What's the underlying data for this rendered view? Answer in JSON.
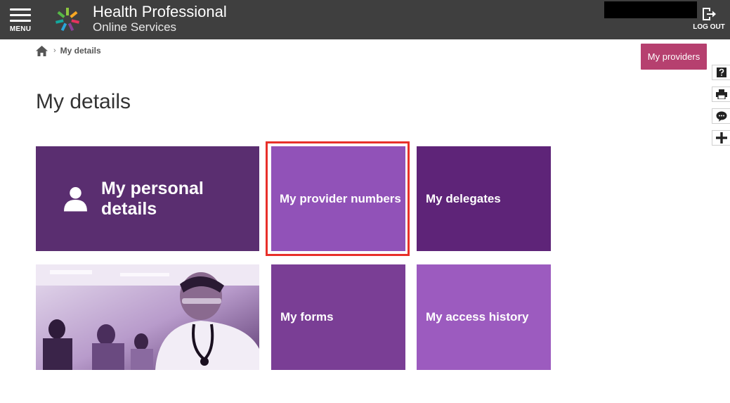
{
  "header": {
    "menu_label": "MENU",
    "brand_line1": "Health Professional",
    "brand_line2": "Online Services",
    "logout_label": "LOG OUT"
  },
  "breadcrumb": {
    "current": "My details"
  },
  "actions": {
    "my_providers": "My providers"
  },
  "page": {
    "title": "My details"
  },
  "tiles": {
    "personal": "My personal details",
    "provider_numbers": "My provider numbers",
    "delegates": "My delegates",
    "forms": "My forms",
    "access_history": "My access history"
  },
  "side_tools": [
    "help-icon",
    "print-icon",
    "feedback-icon",
    "expand-icon"
  ],
  "colors": {
    "topbar": "#3f3f3f",
    "providers_button": "#b6406f",
    "tile_personal": "#5a2e70",
    "tile_provider": "#9152b8",
    "tile_delegates": "#5e2478",
    "tile_forms": "#7a3e95",
    "tile_history": "#9c5bbf",
    "highlight": "#e8302a"
  }
}
